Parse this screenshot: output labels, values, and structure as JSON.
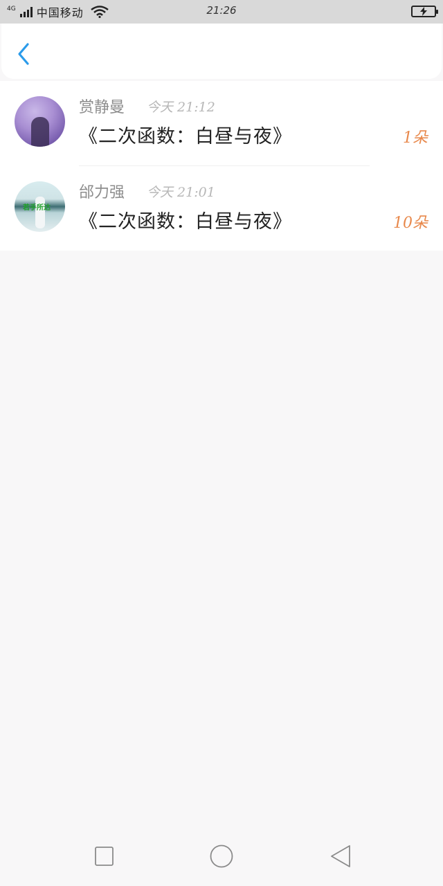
{
  "status_bar": {
    "network_type": "4G",
    "carrier": "中国移动",
    "time": "21:26",
    "wifi_icon": "wifi-icon",
    "battery_icon": "battery-charging-icon"
  },
  "header": {
    "back_icon": "chevron-left-icon",
    "accent_color": "#2b9bea"
  },
  "list": {
    "items": [
      {
        "name": "赏静曼",
        "time": "今天 21:12",
        "title": "《二次函数：白昼与夜》",
        "count": "1朵"
      },
      {
        "name": "邰力强",
        "time": "今天 21:01",
        "title": "《二次函数：白昼与夜》",
        "count": "10朵",
        "avatar_text": "若手所达"
      }
    ]
  },
  "nav_bar": {
    "recent_icon": "square-icon",
    "home_icon": "circle-icon",
    "back_icon": "triangle-back-icon"
  },
  "colors": {
    "count": "#e8884b",
    "background": "#f8f7f8"
  }
}
